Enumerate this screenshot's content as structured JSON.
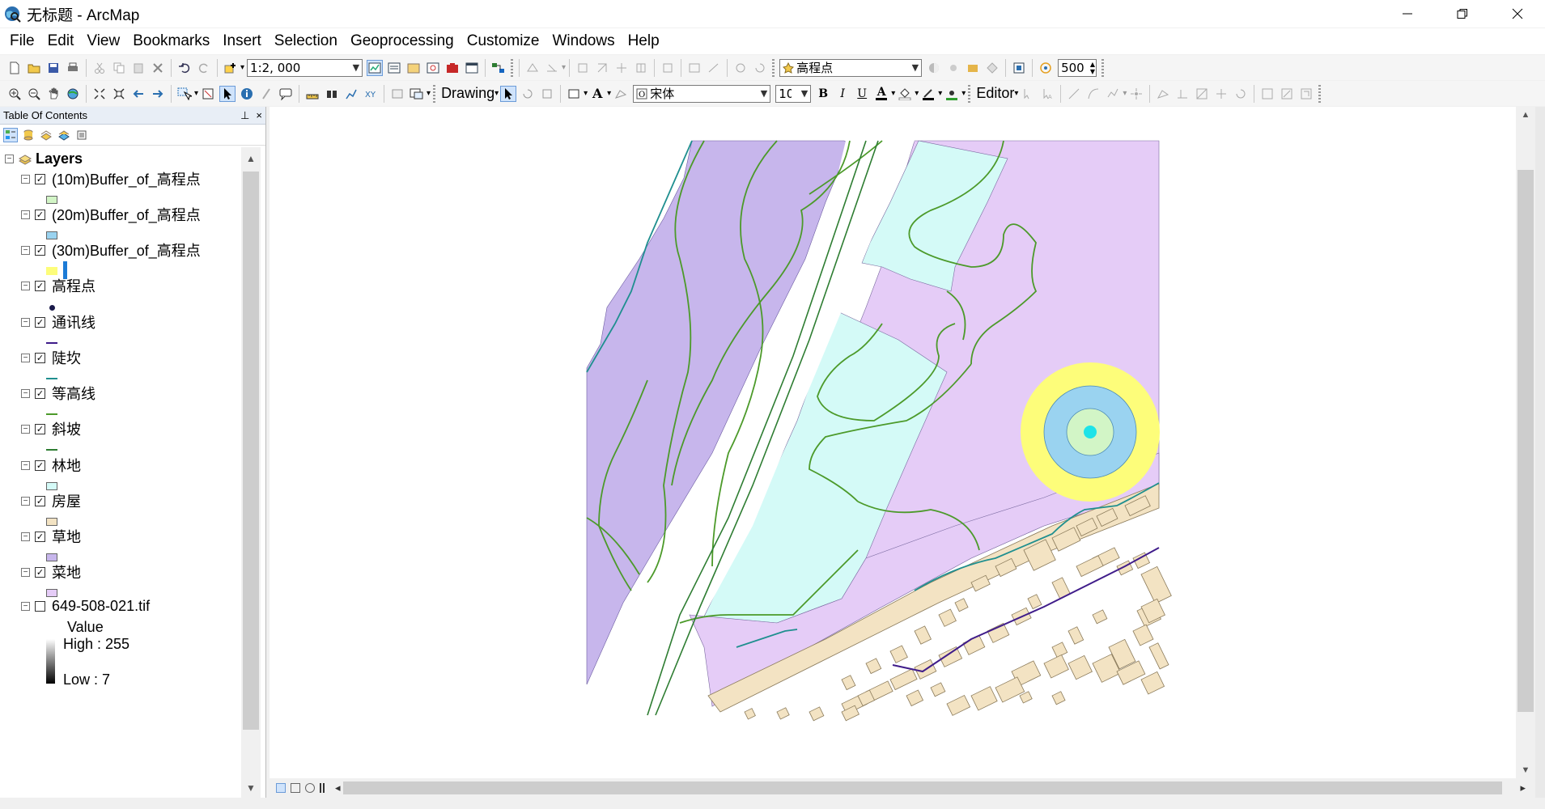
{
  "window": {
    "title": "无标题 - ArcMap",
    "controls": [
      "minimize",
      "restore",
      "close"
    ]
  },
  "menu": [
    "File",
    "Edit",
    "View",
    "Bookmarks",
    "Insert",
    "Selection",
    "Geoprocessing",
    "Customize",
    "Windows",
    "Help"
  ],
  "toolbar1": {
    "scale": "1:2, 000",
    "target_layer": "高程点",
    "distance": "500"
  },
  "toolbar2": {
    "drawing_label": "Drawing",
    "font": "宋体",
    "font_size": "10",
    "bold": "B",
    "italic": "I",
    "underline": "U",
    "font_color": "A",
    "editor_label": "Editor"
  },
  "toc": {
    "title": "Table Of Contents",
    "pin": "⊥",
    "close": "×",
    "root": "Layers",
    "layers": [
      {
        "name": "(10m)Buffer_of_高程点",
        "checked": true,
        "symbol": "fill",
        "color": "#d2f5c6"
      },
      {
        "name": "(20m)Buffer_of_高程点",
        "checked": true,
        "symbol": "fill",
        "color": "#9ad3f0"
      },
      {
        "name": "(30m)Buffer_of_高程点",
        "checked": true,
        "symbol": "fill",
        "color": "#fdfd7a"
      },
      {
        "name": "高程点",
        "checked": true,
        "symbol": "point",
        "color": "#1a1a4a"
      },
      {
        "name": "通讯线",
        "checked": true,
        "symbol": "line",
        "color": "#3f1c8a"
      },
      {
        "name": "陡坎",
        "checked": true,
        "symbol": "line",
        "color": "#1f8f8f"
      },
      {
        "name": "等高线",
        "checked": true,
        "symbol": "line",
        "color": "#4c9a2a"
      },
      {
        "name": "斜坡",
        "checked": true,
        "symbol": "line",
        "color": "#2e7d32"
      },
      {
        "name": "林地",
        "checked": true,
        "symbol": "fill",
        "color": "#d4faf7"
      },
      {
        "name": "房屋",
        "checked": true,
        "symbol": "fill",
        "color": "#f3e3c3"
      },
      {
        "name": "草地",
        "checked": true,
        "symbol": "fill",
        "color": "#c7b6ec"
      },
      {
        "name": "菜地",
        "checked": true,
        "symbol": "fill",
        "color": "#e5ccf7"
      },
      {
        "name": "649-508-021.tif",
        "checked": false,
        "symbol": "raster",
        "color": "#000000"
      }
    ],
    "raster_legend": {
      "heading": "Value",
      "high": "High : 255",
      "low": "Low : 7"
    }
  },
  "colors": {
    "grassland": "#c7b6ec",
    "vegetable": "#e5ccf7",
    "forest": "#d4faf7",
    "house": "#f3e3c3",
    "contour": "#4c9a2a",
    "scarp": "#1f8f8f",
    "comm_line": "#3f1c8a",
    "buffer30": "#fdfd7a",
    "buffer20": "#9ad3f0",
    "buffer10": "#d2f5c6",
    "point": "#1ee3e8"
  }
}
